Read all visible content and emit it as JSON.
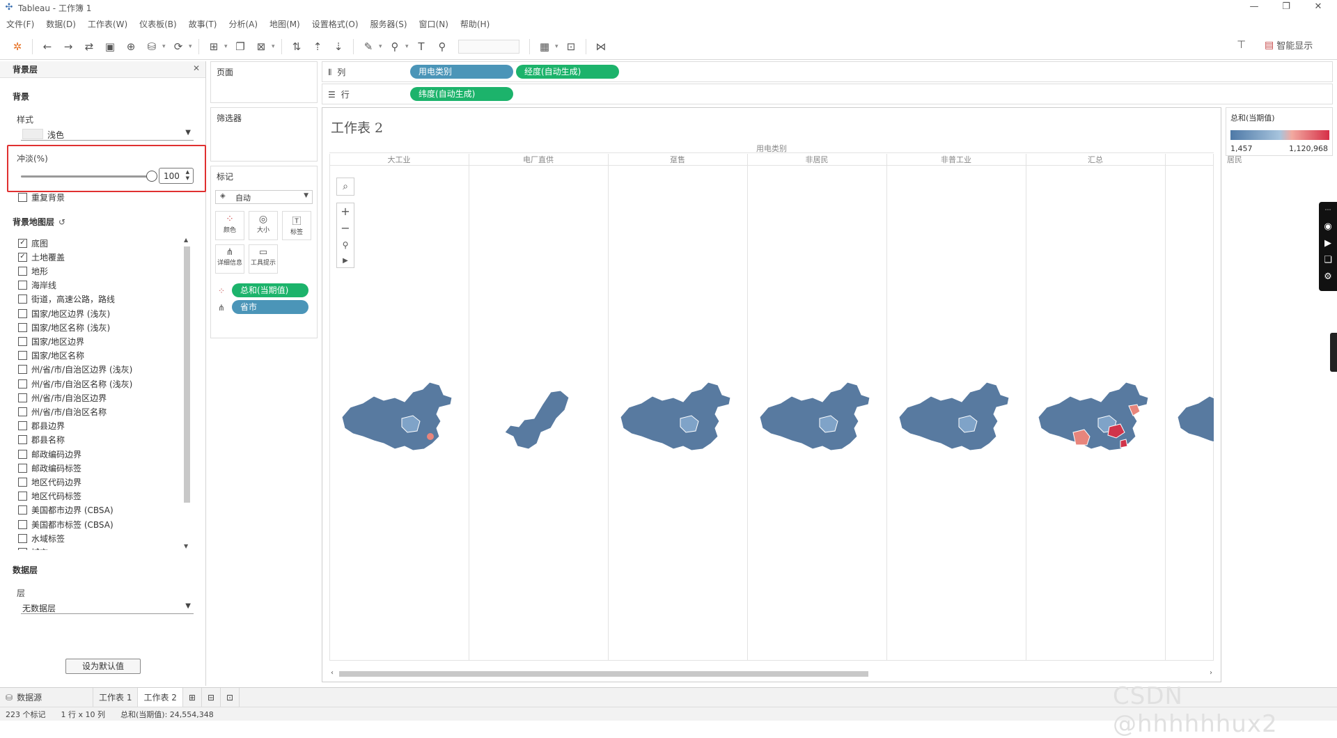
{
  "window": {
    "title": "Tableau - 工作簿 1",
    "min": "—",
    "max": "❐",
    "close": "✕"
  },
  "menu": [
    "文件(F)",
    "数据(D)",
    "工作表(W)",
    "仪表板(B)",
    "故事(T)",
    "分析(A)",
    "地图(M)",
    "设置格式(O)",
    "服务器(S)",
    "窗口(N)",
    "帮助(H)"
  ],
  "toolbar": {
    "smart_show": "智能显示"
  },
  "left_panel": {
    "title": "背景层",
    "background_section": "背景",
    "style_label": "样式",
    "style_value": "浅色",
    "washout_label": "冲淡(%)",
    "washout_value": "100",
    "washout_level": 1.0,
    "repeat_bg": "重复背景",
    "map_layers_section": "背景地图层",
    "layers": [
      {
        "label": "底图",
        "checked": true
      },
      {
        "label": "土地覆盖",
        "checked": true
      },
      {
        "label": "地形",
        "checked": false
      },
      {
        "label": "海岸线",
        "checked": false
      },
      {
        "label": "街道，高速公路，路线",
        "checked": false
      },
      {
        "label": "国家/地区边界 (浅灰)",
        "checked": false
      },
      {
        "label": "国家/地区名称 (浅灰)",
        "checked": false
      },
      {
        "label": "国家/地区边界",
        "checked": false
      },
      {
        "label": "国家/地区名称",
        "checked": false
      },
      {
        "label": "州/省/市/自治区边界 (浅灰)",
        "checked": false
      },
      {
        "label": "州/省/市/自治区名称 (浅灰)",
        "checked": false
      },
      {
        "label": "州/省/市/自治区边界",
        "checked": false
      },
      {
        "label": "州/省/市/自治区名称",
        "checked": false
      },
      {
        "label": "郡县边界",
        "checked": false
      },
      {
        "label": "郡县名称",
        "checked": false
      },
      {
        "label": "邮政编码边界",
        "checked": false
      },
      {
        "label": "邮政编码标签",
        "checked": false
      },
      {
        "label": "地区代码边界",
        "checked": false
      },
      {
        "label": "地区代码标签",
        "checked": false
      },
      {
        "label": "美国都市边界 (CBSA)",
        "checked": false
      },
      {
        "label": "美国都市标签 (CBSA)",
        "checked": false
      },
      {
        "label": "水域标签",
        "checked": false
      },
      {
        "label": "城市",
        "checked": false
      }
    ],
    "data_layer_section": "数据层",
    "layer_label": "层",
    "layer_value": "无数据层",
    "default_button": "设为默认值"
  },
  "pages_card": {
    "title": "页面"
  },
  "filters_card": {
    "title": "筛选器"
  },
  "marks_card": {
    "title": "标记",
    "type": "自动",
    "buttons": [
      "颜色",
      "大小",
      "标签",
      "详细信息",
      "工具提示"
    ],
    "fields": [
      {
        "label": "总和(当期值)",
        "kind": "color"
      },
      {
        "label": "省市",
        "kind": "detail"
      }
    ]
  },
  "shelves": {
    "columns_label": "列",
    "rows_label": "行",
    "columns": [
      "用电类别",
      "经度(自动生成)"
    ],
    "rows": [
      "纬度(自动生成)"
    ]
  },
  "view": {
    "title": "工作表 2",
    "header_title": "用电类别",
    "categories": [
      "大工业",
      "电厂直供",
      "趸售",
      "非居民",
      "非普工业",
      "汇总",
      "居民"
    ]
  },
  "legend": {
    "title": "总和(当期值)",
    "min": "1,457",
    "max": "1,120,968",
    "color_low": "#4e79a7",
    "color_high": "#d62f47"
  },
  "tabs": {
    "datasource": "数据源",
    "sheets": [
      "工作表 1",
      "工作表 2"
    ],
    "active": "工作表 2"
  },
  "status": {
    "marks": "223 个标记",
    "rowscols": "1 行 x 10 列",
    "sum": "总和(当期值): 24,554,348"
  },
  "watermark": "CSDN @hhhhhhux2",
  "colors": {
    "highlight_box": "#e03030",
    "map_blue": "#587aa0",
    "map_blue_light": "#7fa3c8",
    "map_red": "#e8857c",
    "map_red_dark": "#d0344a"
  }
}
